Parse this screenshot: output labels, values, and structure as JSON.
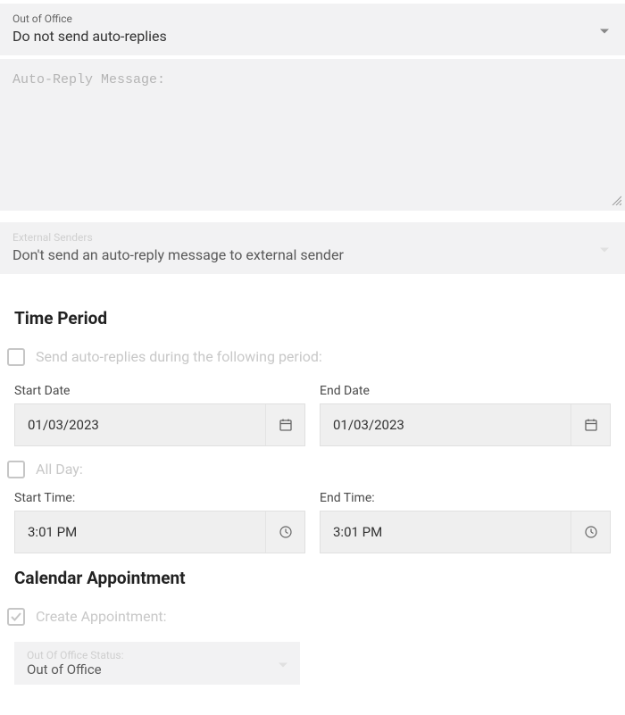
{
  "outOfOffice": {
    "label": "Out of Office",
    "value": "Do not send auto-replies"
  },
  "autoReply": {
    "placeholder": "Auto-Reply Message:"
  },
  "externalSenders": {
    "label": "External Senders",
    "value": "Don't send an auto-reply message to external sender"
  },
  "timePeriod": {
    "title": "Time Period",
    "sendDuringLabel": "Send auto-replies during the following period:",
    "startDateLabel": "Start Date",
    "startDateValue": "01/03/2023",
    "endDateLabel": "End Date",
    "endDateValue": "01/03/2023",
    "allDayLabel": "All Day:",
    "startTimeLabel": "Start Time:",
    "startTimeValue": "3:01 PM",
    "endTimeLabel": "End Time:",
    "endTimeValue": "3:01 PM"
  },
  "calendarAppointment": {
    "title": "Calendar Appointment",
    "createLabel": "Create Appointment:",
    "statusLabel": "Out Of Office Status:",
    "statusValue": "Out of Office"
  }
}
